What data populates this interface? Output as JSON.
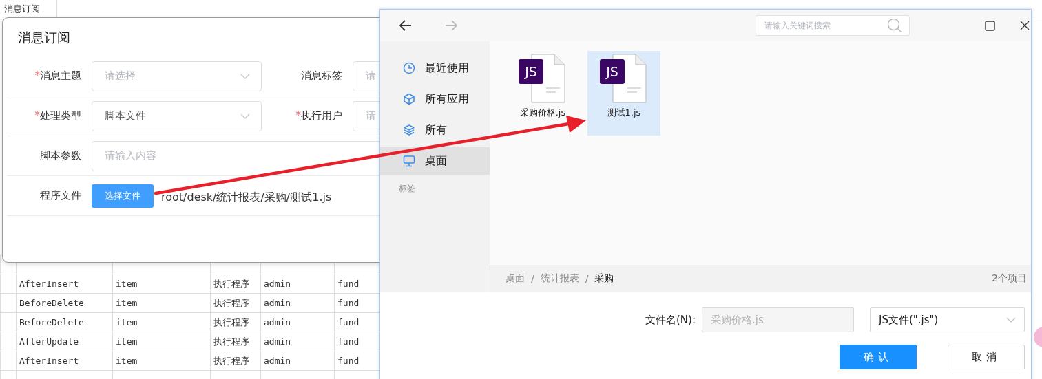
{
  "tab": {
    "label": "消息订阅"
  },
  "table": {
    "rows": [
      [
        "",
        "",
        "",
        "",
        "",
        ""
      ],
      [
        "",
        "AfterInsert",
        "item",
        "执行程序",
        "admin",
        "fund"
      ],
      [
        "",
        "BeforeDelete",
        "item",
        "执行程序",
        "admin",
        "fund"
      ],
      [
        "",
        "BeforeDelete",
        "item",
        "执行程序",
        "admin",
        "fund"
      ],
      [
        "",
        "AfterUpdate",
        "item",
        "执行程序",
        "admin",
        "fund"
      ],
      [
        "",
        "AfterInsert",
        "item",
        "执行程序",
        "admin",
        "fund"
      ],
      [
        "",
        "",
        "",
        "",
        "",
        ""
      ]
    ]
  },
  "subscribe_dialog": {
    "title": "消息订阅",
    "required_mark": "*",
    "rows": [
      {
        "fields": [
          {
            "label": "消息主题",
            "required": true,
            "kind": "select",
            "placeholder": "请选择"
          },
          {
            "label": "消息标签",
            "required": false,
            "kind": "input",
            "placeholder": "请"
          }
        ]
      },
      {
        "fields": [
          {
            "label": "处理类型",
            "required": true,
            "kind": "select",
            "value": "脚本文件"
          },
          {
            "label": "执行用户",
            "required": true,
            "kind": "input",
            "placeholder": "请"
          }
        ]
      },
      {
        "fields": [
          {
            "label": "脚本参数",
            "required": false,
            "kind": "wide",
            "placeholder": "请输入内容"
          }
        ]
      },
      {
        "fields": [
          {
            "label": "程序文件",
            "required": false,
            "kind": "file",
            "button": "选择文件",
            "value": "root/desk/统计报表/采购/测试1.js"
          }
        ]
      }
    ]
  },
  "file_dialog": {
    "nav": {
      "back_disabled": false,
      "forward_disabled": true
    },
    "search": {
      "placeholder": "请输入关键词搜索"
    },
    "sidebar": {
      "items": [
        {
          "label": "最近使用",
          "kind": "recent",
          "selected": false
        },
        {
          "label": "所有应用",
          "kind": "apps",
          "selected": false
        },
        {
          "label": "所有",
          "kind": "all",
          "selected": false
        },
        {
          "label": "桌面",
          "kind": "desktop",
          "selected": true
        }
      ],
      "section_label": "标签"
    },
    "files": [
      {
        "name": "采购价格.js",
        "badge": "JS",
        "selected": false
      },
      {
        "name": "测试1.js",
        "badge": "JS",
        "selected": true
      }
    ],
    "breadcrumb": {
      "separator": "/",
      "items": [
        "桌面",
        "统计报表",
        "采购"
      ]
    },
    "item_count": "2个项目",
    "filename": {
      "label": "文件名(N):",
      "value": "采购价格.js",
      "disabled": true
    },
    "filetype": {
      "value": "JS文件(\".js\")"
    },
    "buttons": [
      {
        "label": "确认",
        "kind": "primary"
      },
      {
        "label": "取消",
        "kind": "default"
      }
    ]
  }
}
